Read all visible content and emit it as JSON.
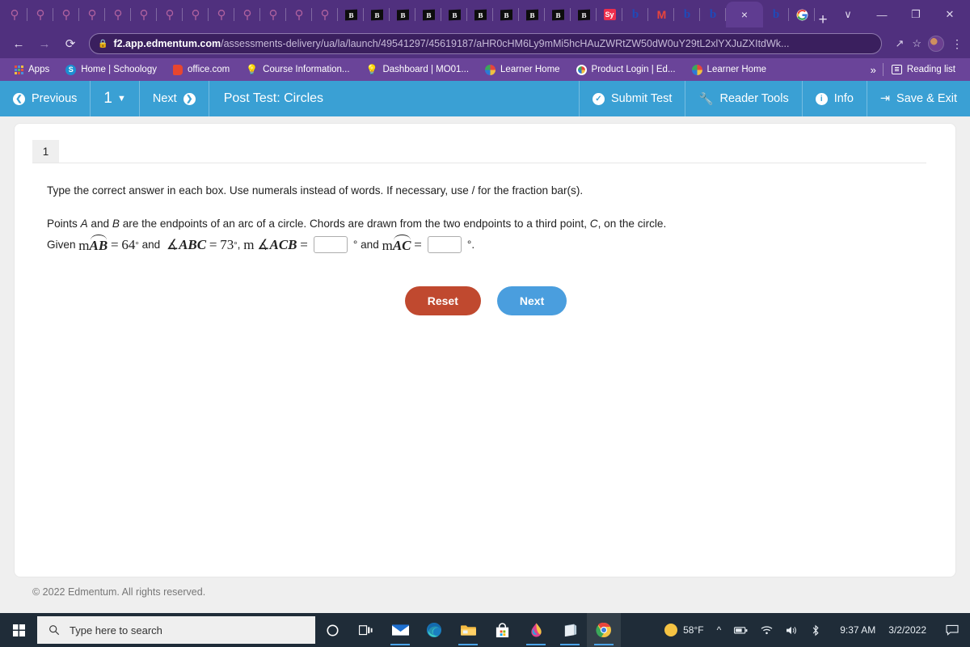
{
  "browser": {
    "tabs": [
      {
        "icon": "bulb-icon",
        "type": "bulb"
      },
      {
        "icon": "bulb-icon",
        "type": "bulb"
      },
      {
        "icon": "bulb-icon",
        "type": "bulb"
      },
      {
        "icon": "bulb-icon",
        "type": "bulb"
      },
      {
        "icon": "bulb-icon",
        "type": "bulb"
      },
      {
        "icon": "bulb-icon",
        "type": "bulb"
      },
      {
        "icon": "bulb-icon",
        "type": "bulb"
      },
      {
        "icon": "bulb-icon",
        "type": "bulb"
      },
      {
        "icon": "bulb-icon",
        "type": "bulb"
      },
      {
        "icon": "bulb-icon",
        "type": "bulb"
      },
      {
        "icon": "bulb-icon",
        "type": "bulb"
      },
      {
        "icon": "bulb-icon",
        "type": "bulb"
      },
      {
        "icon": "bulb-icon",
        "type": "bulb"
      },
      {
        "icon": "blackboard-icon",
        "type": "bb",
        "label": "B"
      },
      {
        "icon": "blackboard-icon",
        "type": "bb",
        "label": "B"
      },
      {
        "icon": "blackboard-icon",
        "type": "bb",
        "label": "B"
      },
      {
        "icon": "blackboard-icon",
        "type": "bb",
        "label": "B"
      },
      {
        "icon": "blackboard-icon",
        "type": "bb",
        "label": "B"
      },
      {
        "icon": "blackboard-icon",
        "type": "bb",
        "label": "B"
      },
      {
        "icon": "blackboard-icon",
        "type": "bb",
        "label": "B"
      },
      {
        "icon": "blackboard-icon",
        "type": "bb",
        "label": "B"
      },
      {
        "icon": "blackboard-icon",
        "type": "bb",
        "label": "B"
      },
      {
        "icon": "blackboard-icon",
        "type": "bb",
        "label": "B"
      },
      {
        "icon": "symbaloo-icon",
        "type": "sy",
        "label": "Sy"
      },
      {
        "icon": "bing-icon",
        "type": "b",
        "label": "b"
      },
      {
        "icon": "gmail-icon",
        "type": "gm",
        "label": "M"
      },
      {
        "icon": "bing-icon",
        "type": "b",
        "label": "b"
      },
      {
        "icon": "bing-icon",
        "type": "b",
        "label": "b"
      },
      {
        "icon": "close-icon",
        "type": "active",
        "label": "×"
      },
      {
        "icon": "bing-icon",
        "type": "b",
        "label": "b"
      },
      {
        "icon": "google-icon",
        "type": "g",
        "label": "G"
      }
    ],
    "new_tab_label": "+",
    "window_controls": [
      "∨",
      "—",
      "❐",
      "✕"
    ],
    "nav": {
      "back": "←",
      "forward": "→",
      "reload": "⟳"
    },
    "url": {
      "host": "f2.app.edmentum.com",
      "path": "/assessments-delivery/ua/la/launch/49541297/45619187/aHR0cHM6Ly9mMi5hcHAuZWRtZW50dW0uY29tL2xlYXJuZXItdWk..."
    },
    "omni_icons": [
      "share-icon",
      "star-icon"
    ],
    "bookmarks": [
      {
        "label": "Apps",
        "icon": "apps-grid-icon"
      },
      {
        "label": "Home | Schoology",
        "icon": "schoology-icon"
      },
      {
        "label": "office.com",
        "icon": "office-icon"
      },
      {
        "label": "Course Information...",
        "icon": "bulb-icon"
      },
      {
        "label": "Dashboard | MO01...",
        "icon": "bulb-icon"
      },
      {
        "label": "Learner Home",
        "icon": "edmentum-icon"
      },
      {
        "label": "Product Login | Ed...",
        "icon": "edmentum-white-icon"
      },
      {
        "label": "Learner Home",
        "icon": "edmentum-icon"
      }
    ],
    "overflow_label": "»",
    "reading_list_label": "Reading list"
  },
  "toolbar": {
    "previous_label": "Previous",
    "page_number": "1",
    "next_label": "Next",
    "title": "Post Test: Circles",
    "submit_label": "Submit Test",
    "reader_tools_label": "Reader Tools",
    "info_label": "Info",
    "save_exit_label": "Save & Exit",
    "accent_color": "#3aa0d4"
  },
  "question": {
    "tab_number": "1",
    "instruction": "Type the correct answer in each box. Use numerals instead of words. If necessary, use / for the fraction bar(s).",
    "prompt_parts": {
      "p1": "Points ",
      "a": "A",
      "p2": " and ",
      "b": "B",
      "p3": " are the endpoints of an arc of a circle. Chords are drawn from the two endpoints to a third point, ",
      "c": "C",
      "p4": ", on the circle."
    },
    "math": {
      "given": "Given",
      "m1": "m",
      "arc_ab": "AB",
      "eq1": "=",
      "val1": "64",
      "deg1": "°",
      "and1": "and",
      "angle_sym1": "∡",
      "angle_abc": "ABC",
      "eq2": "=",
      "val2": "73",
      "deg2": "°",
      "comma": ",",
      "m2": "m",
      "angle_sym2": "∡",
      "angle_acb": "ACB",
      "eq3": "=",
      "input1_value": "",
      "deg3": "°",
      "and2": "and",
      "m3": "m",
      "arc_ac": "AC",
      "eq4": "=",
      "input2_value": "",
      "deg4": "°",
      "period": "."
    },
    "reset_label": "Reset",
    "next_label": "Next",
    "reset_color": "#c0492f",
    "next_color": "#4a9ede"
  },
  "footer": {
    "copyright": "© 2022 Edmentum. All rights reserved."
  },
  "taskbar": {
    "search_placeholder": "Type here to search",
    "icons": [
      {
        "name": "cortana-icon"
      },
      {
        "name": "task-view-icon"
      },
      {
        "name": "mail-icon"
      },
      {
        "name": "edge-icon"
      },
      {
        "name": "file-explorer-icon"
      },
      {
        "name": "microsoft-store-icon"
      },
      {
        "name": "paint-3d-icon"
      },
      {
        "name": "sticky-notes-icon"
      },
      {
        "name": "chrome-icon"
      }
    ],
    "weather_temp": "58°F",
    "tray": [
      "chevron-up-icon",
      "battery-icon",
      "wifi-icon",
      "volume-icon",
      "bluetooth-icon"
    ],
    "time": "9:37 AM",
    "date": "3/2/2022",
    "notification_icon": "notification-icon"
  }
}
